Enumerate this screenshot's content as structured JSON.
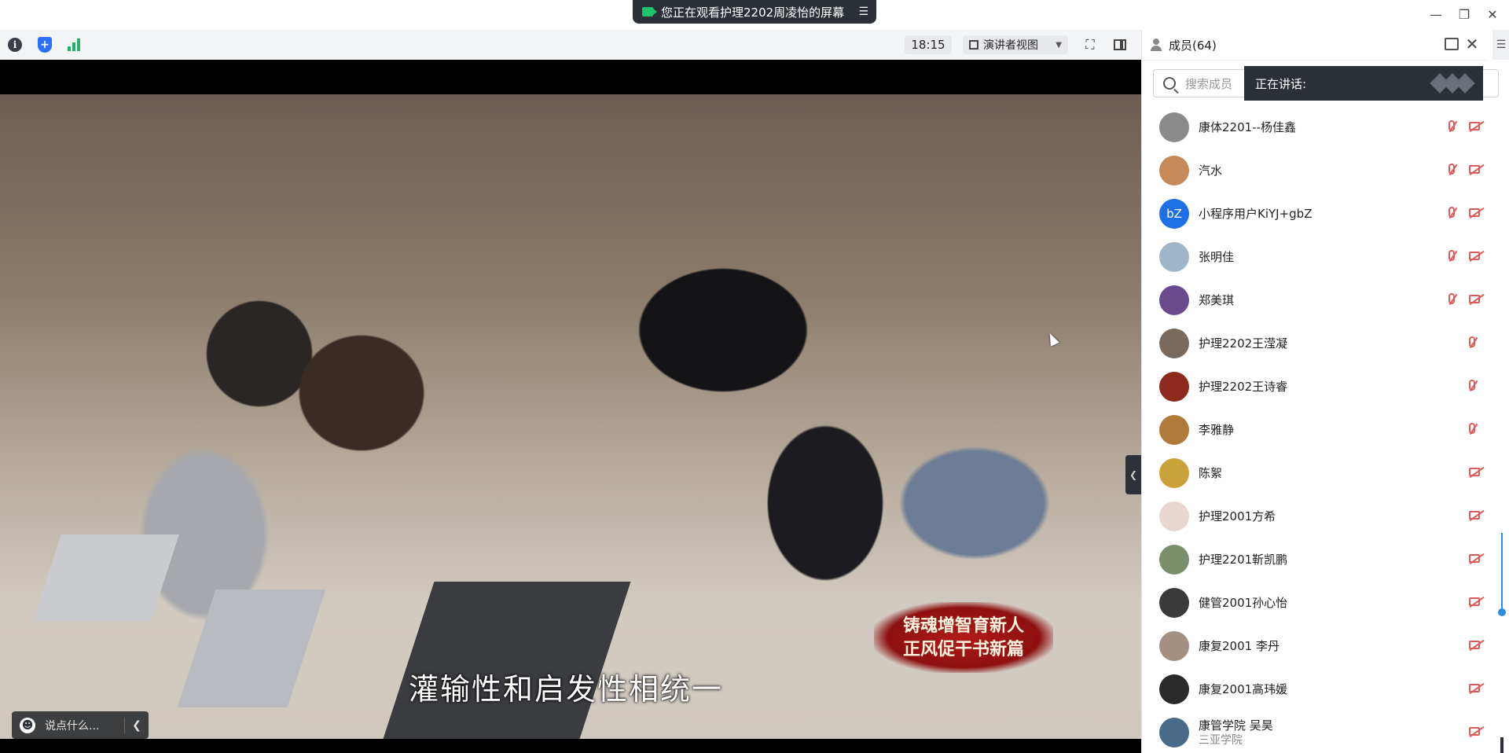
{
  "top": {
    "share_banner": "您正在观看护理2202周凌怡的屏幕"
  },
  "toolbar": {
    "timer": "18:15",
    "view_mode": "演讲者视图"
  },
  "video": {
    "subtitle": "灌输性和启发性相统一",
    "seal_line1": "铸魂增智育新人",
    "seal_line2": "正风促干书新篇"
  },
  "chat": {
    "placeholder": "说点什么..."
  },
  "panel": {
    "title": "成员(64)",
    "search_placeholder": "搜索成员",
    "speaking_label": "正在讲话:"
  },
  "members": [
    {
      "name": "康体2201--杨佳鑫",
      "avatar_color": "#8a8a8a",
      "avatar_text": "",
      "mic_off": true,
      "cam_off": true
    },
    {
      "name": "汽水",
      "avatar_color": "#c68a5a",
      "avatar_text": "",
      "mic_off": true,
      "cam_off": true
    },
    {
      "name": "小程序用户KiYJ+gbZ",
      "avatar_color": "#1f6fe5",
      "avatar_text": "bZ",
      "mic_off": true,
      "cam_off": true
    },
    {
      "name": "张明佳",
      "avatar_color": "#9fb5c9",
      "avatar_text": "",
      "mic_off": true,
      "cam_off": true
    },
    {
      "name": "郑美琪",
      "avatar_color": "#6a4a8c",
      "avatar_text": "",
      "mic_off": true,
      "cam_off": true
    },
    {
      "name": "护理2202王滢凝",
      "avatar_color": "#7a6a5e",
      "avatar_text": "",
      "mic_off": true,
      "cam_off": false
    },
    {
      "name": "护理2202王诗睿",
      "avatar_color": "#8c2a1e",
      "avatar_text": "",
      "mic_off": true,
      "cam_off": false
    },
    {
      "name": "李雅静",
      "avatar_color": "#b07a3a",
      "avatar_text": "",
      "mic_off": true,
      "cam_off": false
    },
    {
      "name": "陈絮",
      "avatar_color": "#c9a23a",
      "avatar_text": "",
      "mic_off": false,
      "cam_off": true
    },
    {
      "name": "护理2001方希",
      "avatar_color": "#e8d6d0",
      "avatar_text": "",
      "mic_off": false,
      "cam_off": true
    },
    {
      "name": "护理2201靳凯鹏",
      "avatar_color": "#7a8f6a",
      "avatar_text": "",
      "mic_off": false,
      "cam_off": true
    },
    {
      "name": "健管2001孙心怡",
      "avatar_color": "#3a3a3a",
      "avatar_text": "",
      "mic_off": false,
      "cam_off": true
    },
    {
      "name": "康复2001 李丹",
      "avatar_color": "#a58f80",
      "avatar_text": "",
      "mic_off": false,
      "cam_off": true
    },
    {
      "name": "康复2001高玮媛",
      "avatar_color": "#2a2a2a",
      "avatar_text": "",
      "mic_off": false,
      "cam_off": true
    },
    {
      "name": "康管学院 吴昊",
      "sub": "三亚学院",
      "avatar_color": "#4a6a8a",
      "avatar_text": "",
      "mic_off": false,
      "cam_off": true
    }
  ]
}
